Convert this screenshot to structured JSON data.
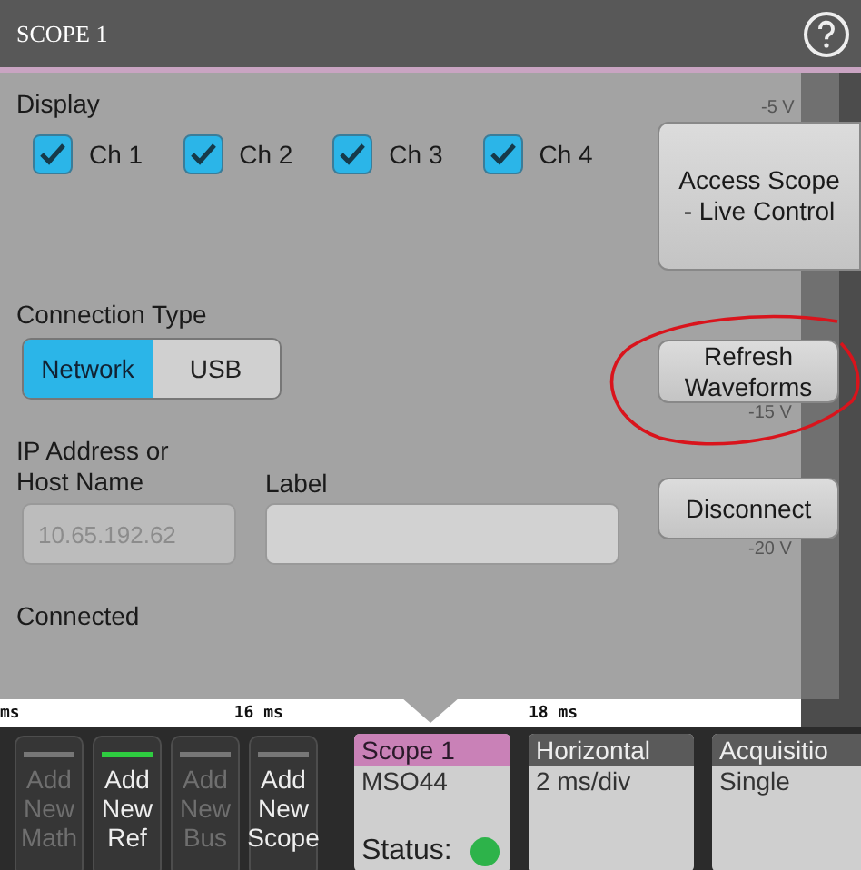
{
  "window": {
    "title": "SCOPE 1"
  },
  "display": {
    "label": "Display",
    "channels": [
      {
        "label": "Ch 1",
        "checked": true
      },
      {
        "label": "Ch 2",
        "checked": true
      },
      {
        "label": "Ch 3",
        "checked": true
      },
      {
        "label": "Ch 4",
        "checked": true
      }
    ]
  },
  "connection_type": {
    "label": "Connection Type",
    "options": [
      {
        "label": "Network",
        "selected": true
      },
      {
        "label": "USB",
        "selected": false
      }
    ]
  },
  "ip_address": {
    "label": "IP Address or Host Name",
    "placeholder": "10.65.192.62"
  },
  "label_field": {
    "label": "Label"
  },
  "status_text": "Connected",
  "buttons": {
    "access": "Access Scope - Live Control",
    "refresh": "Refresh Waveforms",
    "disconnect": "Disconnect"
  },
  "scale_labels": [
    "-5 V",
    "-15 V",
    "-20 V"
  ],
  "ruler_labels": [
    "ms",
    "16 ms",
    "18 ms"
  ],
  "add_buttons": [
    {
      "label": "Add New Math",
      "disabled": true,
      "active": false
    },
    {
      "label": "Add New Ref",
      "disabled": false,
      "active": true
    },
    {
      "label": "Add New Bus",
      "disabled": true,
      "active": false
    },
    {
      "label": "Add New Scope",
      "disabled": false,
      "active": false
    }
  ],
  "badges": [
    {
      "title": "Scope 1",
      "selected": true,
      "lines": [
        "MSO44"
      ],
      "status": {
        "label": "Status:",
        "color": "#2db34a"
      }
    },
    {
      "title": "Horizontal",
      "selected": false,
      "lines": [
        "2 ms/div"
      ]
    },
    {
      "title": "Acquisitio",
      "selected": false,
      "lines": [
        "Single"
      ]
    }
  ]
}
